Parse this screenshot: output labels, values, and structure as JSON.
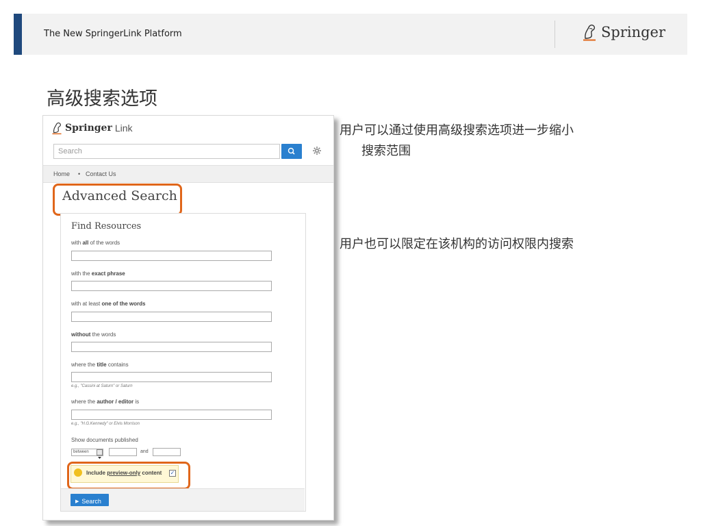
{
  "header": {
    "title": "The New SpringerLink Platform",
    "logo_text": "Springer"
  },
  "slide_title": "高级搜索选项",
  "notes": {
    "note1_line1": "用户可以通过使用高级搜索选项进一步缩小",
    "note1_line2": "搜索范围",
    "note2": "用户也可以限定在该机构的访问权限内搜索"
  },
  "screenshot": {
    "brand": "Springer",
    "brand_link": "Link",
    "search_placeholder": "Search",
    "nav": {
      "home": "Home",
      "sep": "•",
      "contact": "Contact Us"
    },
    "advanced_title": "Advanced Search",
    "form_title": "Find Resources",
    "fields": {
      "all_pre": "with ",
      "all_bold": "all",
      "all_post": " of the words",
      "exact_pre": "with the ",
      "exact_bold": "exact phrase",
      "one_pre": "with at least ",
      "one_bold": "one of the words",
      "without_bold": "without",
      "without_post": " the words",
      "title_pre": "where the ",
      "title_bold": "title",
      "title_post": " contains",
      "title_eg": "e.g., \"Cassini at Saturn\" or Saturn",
      "author_pre": "where the ",
      "author_bold": "author / editor",
      "author_post": " is",
      "author_eg": "e.g., \"H.G.Kennedy\" or Elvis Morrison"
    },
    "published_label": "Show documents published",
    "between_value": "between",
    "and_label": "and",
    "preview_pre": "Include ",
    "preview_link": "preview-only",
    "preview_post": " content",
    "preview_checked": "✓",
    "search_button": "Search"
  }
}
